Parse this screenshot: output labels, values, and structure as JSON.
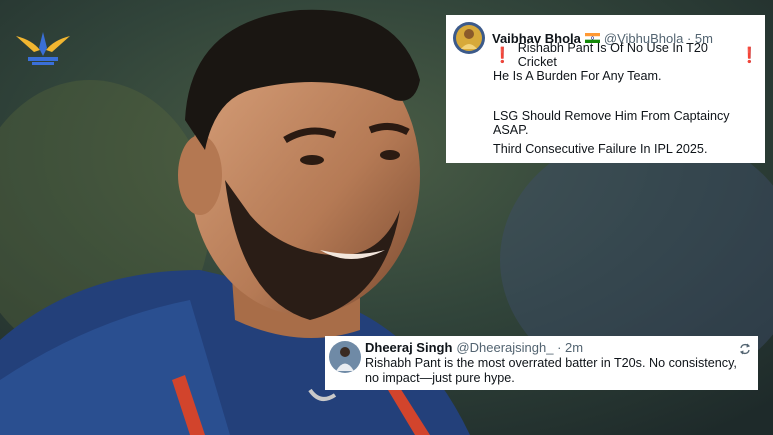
{
  "tweet_top": {
    "name": "Vaibhav Bhola",
    "handle": "@VibhuBhola · 5m",
    "line1": "Rishabh Pant Is Of No Use In T20 Cricket",
    "para1": "He Is A Burden For Any Team.",
    "para2": "LSG Should Remove Him From Captaincy ASAP.",
    "para3": "Third Consecutive Failure In IPL 2025."
  },
  "tweet_bottom": {
    "name": "Dheeraj Singh",
    "handle": "@Dheerajsingh_ · 2m",
    "text": "Rishabh Pant is the most overrated batter in T20s. No consistency, no impact—just pure hype."
  },
  "icons": [
    "team-logo-icon",
    "india-flag-icon",
    "exclamation-icon",
    "retweet-icon"
  ],
  "colors": {
    "accent_red": "#e0245e",
    "handle_gray": "#536471"
  }
}
